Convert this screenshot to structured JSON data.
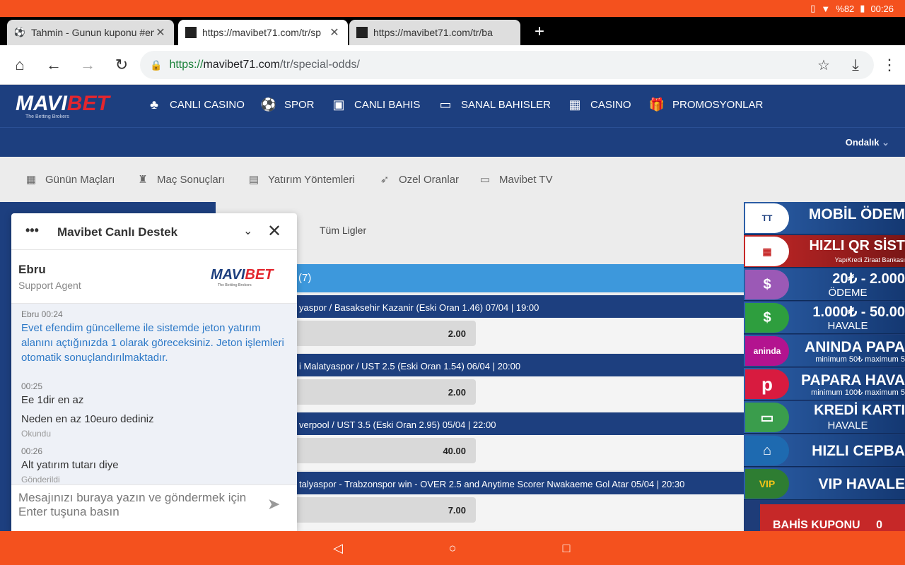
{
  "status_bar": {
    "battery": "%82",
    "time": "00:26"
  },
  "tabs": [
    {
      "title": "Tahmin - Gunun kuponu #em",
      "favicon": "soccer-ball",
      "active": false
    },
    {
      "title": "https://mavibet71.com/tr/sp",
      "favicon": "mavibet",
      "active": true
    },
    {
      "title": "https://mavibet71.com/tr/ba",
      "favicon": "mavibet",
      "active": false
    }
  ],
  "address": {
    "scheme": "https://",
    "host": "mavibet71.com",
    "path": "/tr/special-odds/"
  },
  "site": {
    "logo_main": "MAVI",
    "logo_accent": "BET",
    "logo_tagline": "The Betting Brokers",
    "nav": [
      "CANLI CASINO",
      "SPOR",
      "CANLI BAHIS",
      "SANAL BAHISLER",
      "CASINO",
      "PROMOSYONLAR"
    ],
    "odds_format": "Ondalık",
    "secondary_nav": [
      "Günün Maçları",
      "Maç Sonuçları",
      "Yatırım Yöntemleri",
      "Ozel Oranlar",
      "Mavibet TV"
    ]
  },
  "content": {
    "filter_label": "Tüm Ligler",
    "category_count": "(7)",
    "matches": [
      {
        "title": "yaspor / Basaksehir Kazanir (Eski Oran 1.46) 07/04 | 19:00",
        "odd": "2.00"
      },
      {
        "title": "i Malatyaspor / UST 2.5 (Eski Oran 1.54) 06/04 | 20:00",
        "odd": "2.00"
      },
      {
        "title": "verpool / UST 3.5 (Eski Oran 2.95) 05/04 | 22:00",
        "odd": "40.00"
      },
      {
        "title": "talyaspor - Trabzonspor win - OVER 2.5 and Anytime Scorer Nwakaeme Gol Atar  05/04 | 20:30",
        "odd": "7.00"
      }
    ]
  },
  "banners": [
    {
      "line1": "MOBİL ÖDEM",
      "line2": "",
      "icon": "T"
    },
    {
      "line1": "HIZLI QR SİST",
      "line2": "YapıKredi  Ziraat Bankası",
      "icon": "QR"
    },
    {
      "line1": "20₺ - 2.000",
      "line2": "ÖDEME",
      "icon": "$"
    },
    {
      "line1": "1.000₺ - 50.00",
      "line2": "HAVALE",
      "icon": "$"
    },
    {
      "line1": "ANINDA PAPA",
      "line2": "minimum 50₺   maximum 5",
      "icon": "a"
    },
    {
      "line1": "PAPARA HAVA",
      "line2": "minimum 100₺   maximum 5",
      "icon": "P"
    },
    {
      "line1": "KREDİ KARTI",
      "line2": "HAVALE",
      "icon": "▭"
    },
    {
      "line1": "HIZLI CEPBA",
      "line2": "",
      "icon": "🏛"
    },
    {
      "line1": "VIP HAVALE",
      "line2": "",
      "icon": "VIP"
    }
  ],
  "betslip": {
    "label": "BAHİS KUPONU",
    "count": "0"
  },
  "chat": {
    "title": "Mavibet Canlı Destek",
    "agent_name": "Ebru",
    "agent_role": "Support Agent",
    "messages": {
      "m1_meta": "Ebru 00:24",
      "m1_text": "Evet efendim güncelleme ile sistemde jeton yatırım alanını açtığınızda 1 olarak göreceksiniz. Jeton işlemleri otomatik sonuçlandırılmaktadır.",
      "m2_meta": "00:25",
      "m2_text": "Ee 1dir en az",
      "m3_text": "Neden en az 10euro dediniz",
      "m3_status": "Okundu",
      "m4_meta": "00:26",
      "m4_text": "Alt yatırım tutarı diye",
      "m4_status": "Gönderildi"
    },
    "input_placeholder": "Mesajınızı buraya yazın ve göndermek için Enter tuşuna basın"
  },
  "colors": {
    "brand_blue": "#1d3f7f",
    "accent_orange": "#f4511e",
    "category_blue": "#3d98dc",
    "betslip_red": "#c62828"
  }
}
